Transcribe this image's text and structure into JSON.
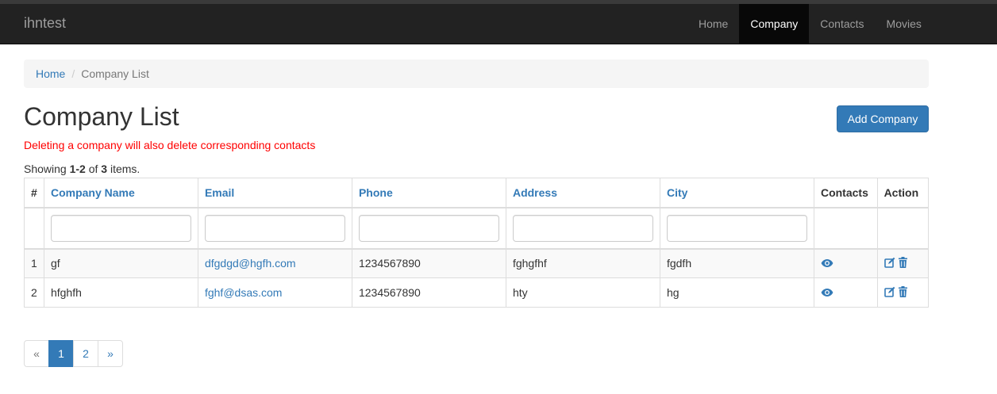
{
  "navbar": {
    "brand": "ihntest",
    "items": [
      {
        "label": "Home",
        "active": false
      },
      {
        "label": "Company",
        "active": true
      },
      {
        "label": "Contacts",
        "active": false
      },
      {
        "label": "Movies",
        "active": false
      }
    ]
  },
  "breadcrumb": {
    "home": "Home",
    "separator": "/",
    "current": "Company List"
  },
  "page": {
    "title": "Company List",
    "add_button": "Add Company",
    "warning": "Deleting a company will also delete corresponding contacts",
    "summary": {
      "prefix": "Showing ",
      "range": "1-2",
      "middle": " of ",
      "total": "3",
      "suffix": " items."
    }
  },
  "table": {
    "headers": [
      "#",
      "Company Name",
      "Email",
      "Phone",
      "Address",
      "City",
      "Contacts",
      "Action"
    ],
    "filters": {
      "company_name": "",
      "email": "",
      "phone": "",
      "address": "",
      "city": ""
    },
    "rows": [
      {
        "num": "1",
        "company_name": "gf",
        "email": "dfgdgd@hgfh.com",
        "phone": "1234567890",
        "address": "fghgfhf",
        "city": "fgdfh"
      },
      {
        "num": "2",
        "company_name": "hfghfh",
        "email": "fghf@dsas.com",
        "phone": "1234567890",
        "address": "hty",
        "city": "hg"
      }
    ],
    "icons": {
      "view": "eye-icon",
      "edit": "edit-icon",
      "delete": "trash-icon"
    }
  },
  "pagination": {
    "prev": "«",
    "pages": [
      "1",
      "2"
    ],
    "active_page": "1",
    "next": "»"
  },
  "colors": {
    "navbar_bg": "#222222",
    "primary": "#337ab7",
    "warning": "#ff0000"
  }
}
